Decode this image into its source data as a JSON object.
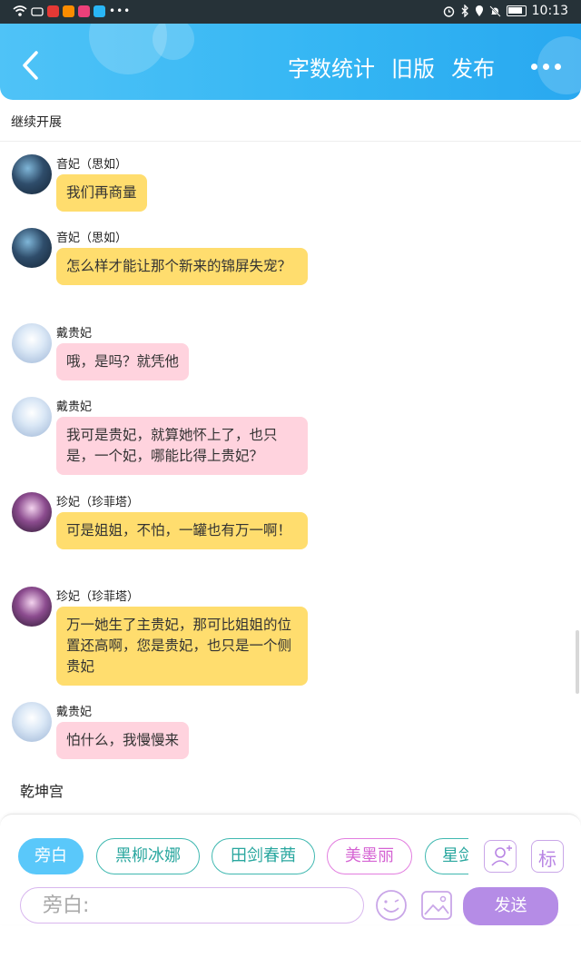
{
  "status_bar": {
    "time": "10:13",
    "left_icons": [
      "wifi-icon",
      "cloud-icon",
      "app-red-icon",
      "app-orange-icon",
      "app-pink-icon",
      "app-blue-icon",
      "more-dots-icon"
    ],
    "right_icons": [
      "alarm-icon",
      "bluetooth-icon",
      "location-icon",
      "mute-icon",
      "battery-icon"
    ]
  },
  "header": {
    "actions": [
      "字数统计",
      "旧版",
      "发布"
    ],
    "accent_color": "#33b5f3"
  },
  "continue_label": "继续开展",
  "messages": [
    {
      "name": "音妃（思如）",
      "text": "我们再商量",
      "color": "yellow",
      "avatar": "night-scene-avatar"
    },
    {
      "name": "音妃（思如）",
      "text": "怎么样才能让那个新来的锦屏失宠？",
      "color": "yellow",
      "avatar": "night-scene-avatar"
    },
    {
      "name": "戴贵妃",
      "text": "哦，是吗？就凭他",
      "color": "pink",
      "avatar": "ice-girl-avatar"
    },
    {
      "name": "戴贵妃",
      "text": "我可是贵妃，就算她怀上了，也只是，一个妃，哪能比得上贵妃？",
      "color": "pink",
      "avatar": "ice-girl-avatar"
    },
    {
      "name": "珍妃（珍菲塔）",
      "text": "可是姐姐，不怕，一罐也有万一啊！",
      "color": "yellow",
      "avatar": "rose-girl-avatar"
    },
    {
      "name": "珍妃（珍菲塔）",
      "text": "万一她生了主贵妃，那可比姐姐的位置还高啊，您是贵妃，也只是一个侧贵妃",
      "color": "yellow",
      "avatar": "rose-girl-avatar"
    },
    {
      "name": "戴贵妃",
      "text": "怕什么，我慢慢来",
      "color": "pink",
      "avatar": "ice-girl-avatar"
    }
  ],
  "section_label": "乾坤宫",
  "chips": [
    "旁白",
    "黑柳冰娜",
    "田剑春茜",
    "美墨丽",
    "星剑"
  ],
  "side_buttons": {
    "tag_label": "标"
  },
  "input": {
    "placeholder": "旁白:"
  },
  "send_label": "发送",
  "colors": {
    "yellow_bubble": "#ffdd6e",
    "pink_bubble": "#ffd3de",
    "send": "#b58ce6",
    "chip_active": "#5ac8fa"
  }
}
